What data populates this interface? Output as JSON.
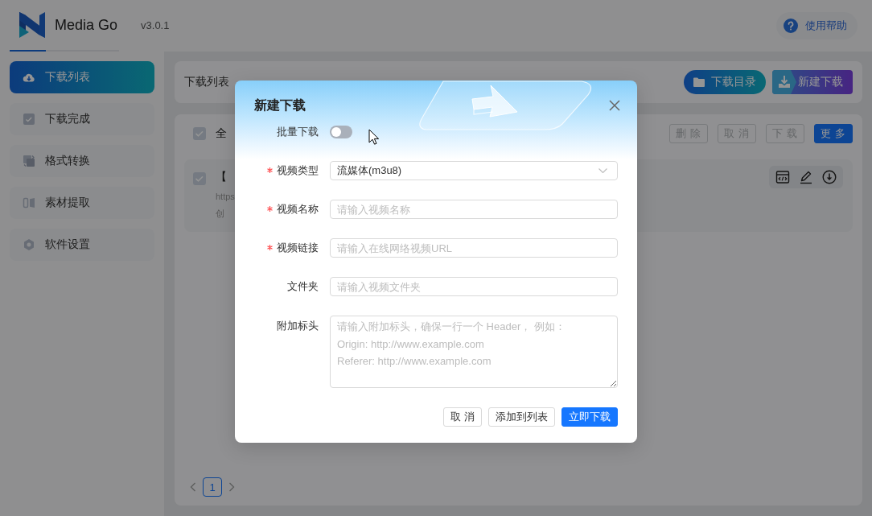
{
  "header": {
    "app_name": "Media Go",
    "version": "v3.0.1",
    "help_link": "使用帮助"
  },
  "sidebar": {
    "items": [
      {
        "label": "下载列表",
        "selected": true
      },
      {
        "label": "下载完成",
        "selected": false
      },
      {
        "label": "格式转换",
        "selected": false
      },
      {
        "label": "素材提取",
        "selected": false
      },
      {
        "label": "软件设置",
        "selected": false
      }
    ]
  },
  "page_header": {
    "title": "下载列表",
    "buttons": [
      {
        "label": "下载目录",
        "kind": "secondary"
      },
      {
        "label": "新建下载",
        "kind": "primary"
      }
    ]
  },
  "toolbar": {
    "select_all": {
      "label": "全",
      "checked": false
    },
    "buttons": [
      {
        "label": "删 除",
        "disabled": true
      },
      {
        "label": "取 消",
        "disabled": true
      },
      {
        "label": "下 载",
        "disabled": true
      },
      {
        "label": "更 多",
        "disabled": false
      }
    ]
  },
  "items": [
    {
      "title": "【",
      "url": "https",
      "created": "创",
      "checked": false
    }
  ],
  "pagination": {
    "pages": [
      {
        "label": "1",
        "selected": true
      }
    ]
  },
  "dialog": {
    "title": "新建下载",
    "fields": [
      {
        "kind": "switch",
        "label": "批量下载",
        "required": false,
        "on": false
      },
      {
        "kind": "select",
        "label": "视频类型",
        "required": true,
        "value": "流媒体(m3u8)"
      },
      {
        "kind": "input",
        "label": "视频名称",
        "required": true,
        "placeholder": "请输入视频名称"
      },
      {
        "kind": "input",
        "label": "视频链接",
        "required": true,
        "placeholder": "请输入在线网络视频URL"
      },
      {
        "kind": "input",
        "label": "文件夹",
        "required": false,
        "placeholder": "请输入视频文件夹"
      },
      {
        "kind": "textarea",
        "label": "附加标头",
        "required": false,
        "placeholder": "请输入附加标头，确保一行一个 Header， 例如：\nOrigin: http://www.example.com\nReferer: http://www.example.com"
      }
    ],
    "buttons": [
      {
        "label": "取 消",
        "kind": "default"
      },
      {
        "label": "添加到列表",
        "kind": "default"
      },
      {
        "label": "立即下载",
        "kind": "primary"
      }
    ]
  }
}
